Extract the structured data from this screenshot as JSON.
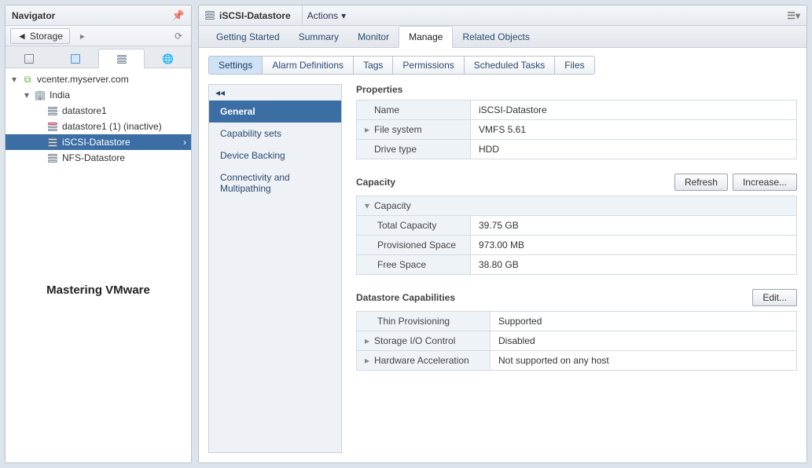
{
  "navigator": {
    "title": "Navigator",
    "breadcrumb_label": "Storage",
    "tree": {
      "root": "vcenter.myserver.com",
      "dc": "India",
      "items": [
        {
          "label": "datastore1"
        },
        {
          "label": "datastore1 (1) (inactive)"
        },
        {
          "label": "iSCSI-Datastore",
          "selected": true
        },
        {
          "label": "NFS-Datastore"
        }
      ]
    },
    "watermark": "Mastering VMware"
  },
  "main": {
    "title": "iSCSI-Datastore",
    "actions_label": "Actions",
    "top_tabs": [
      "Getting Started",
      "Summary",
      "Monitor",
      "Manage",
      "Related Objects"
    ],
    "top_tab_active": 3,
    "sub_tabs": [
      "Settings",
      "Alarm Definitions",
      "Tags",
      "Permissions",
      "Scheduled Tasks",
      "Files"
    ],
    "sub_tab_active": 0,
    "side_menu": [
      "General",
      "Capability sets",
      "Device Backing",
      "Connectivity and Multipathing"
    ],
    "side_menu_active": 0,
    "sections": {
      "properties_title": "Properties",
      "properties": [
        {
          "k": "Name",
          "v": "iSCSI-Datastore"
        },
        {
          "k": "File system",
          "v": "VMFS 5.61",
          "expandable": true
        },
        {
          "k": "Drive type",
          "v": "HDD"
        }
      ],
      "capacity_title": "Capacity",
      "capacity_group_label": "Capacity",
      "capacity": [
        {
          "k": "Total Capacity",
          "v": "39.75 GB"
        },
        {
          "k": "Provisioned Space",
          "v": "973.00 MB"
        },
        {
          "k": "Free Space",
          "v": "38.80 GB"
        }
      ],
      "capabilities_title": "Datastore Capabilities",
      "capabilities": [
        {
          "k": "Thin Provisioning",
          "v": "Supported"
        },
        {
          "k": "Storage I/O Control",
          "v": "Disabled",
          "expandable": true
        },
        {
          "k": "Hardware Acceleration",
          "v": "Not supported on any host",
          "expandable": true
        }
      ],
      "buttons": {
        "refresh": "Refresh",
        "increase": "Increase...",
        "edit": "Edit..."
      }
    }
  }
}
